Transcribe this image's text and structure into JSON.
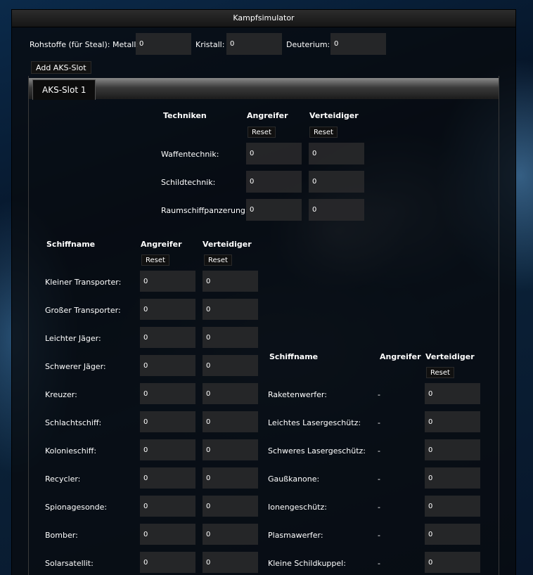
{
  "window": {
    "title": "Kampfsimulator"
  },
  "resources": {
    "label": "Rohstoffe (für Steal): Metall:",
    "metal": "0",
    "crystal_label": "Kristall:",
    "crystal": "0",
    "deuterium_label": "Deuterium:",
    "deuterium": "0"
  },
  "add_slot_label": "Add AKS-Slot",
  "tab_label": "AKS-Slot 1",
  "tech": {
    "header": "Techniken",
    "attacker": "Angreifer",
    "defender": "Verteidiger",
    "reset": "Reset",
    "rows": [
      {
        "name": "Waffentechnik:",
        "attacker": "0",
        "defender": "0"
      },
      {
        "name": "Schildtechnik:",
        "attacker": "0",
        "defender": "0"
      },
      {
        "name": "Raumschiffpanzerung:",
        "attacker": "0",
        "defender": "0"
      }
    ]
  },
  "ships": {
    "header": "Schiffname",
    "attacker": "Angreifer",
    "defender": "Verteidiger",
    "reset": "Reset",
    "rows": [
      {
        "name": "Kleiner Transporter:",
        "attacker": "0",
        "defender": "0"
      },
      {
        "name": "Großer Transporter:",
        "attacker": "0",
        "defender": "0"
      },
      {
        "name": "Leichter Jäger:",
        "attacker": "0",
        "defender": "0"
      },
      {
        "name": "Schwerer Jäger:",
        "attacker": "0",
        "defender": "0"
      },
      {
        "name": "Kreuzer:",
        "attacker": "0",
        "defender": "0"
      },
      {
        "name": "Schlachtschiff:",
        "attacker": "0",
        "defender": "0"
      },
      {
        "name": "Kolonieschiff:",
        "attacker": "0",
        "defender": "0"
      },
      {
        "name": "Recycler:",
        "attacker": "0",
        "defender": "0"
      },
      {
        "name": "Spionagesonde:",
        "attacker": "0",
        "defender": "0"
      },
      {
        "name": "Bomber:",
        "attacker": "0",
        "defender": "0"
      },
      {
        "name": "Solarsatellit:",
        "attacker": "0",
        "defender": "0"
      }
    ]
  },
  "defense": {
    "header": "Schiffname",
    "attacker": "Angreifer",
    "defender": "Verteidiger",
    "reset": "Reset",
    "rows": [
      {
        "name": "Raketenwerfer:",
        "attacker": "-",
        "defender": "0"
      },
      {
        "name": "Leichtes Lasergeschütz:",
        "attacker": "-",
        "defender": "0"
      },
      {
        "name": "Schweres Lasergeschütz:",
        "attacker": "-",
        "defender": "0"
      },
      {
        "name": "Gaußkanone:",
        "attacker": "-",
        "defender": "0"
      },
      {
        "name": "Ionengeschütz:",
        "attacker": "-",
        "defender": "0"
      },
      {
        "name": "Plasmawerfer:",
        "attacker": "-",
        "defender": "0"
      },
      {
        "name": "Kleine Schildkuppel:",
        "attacker": "-",
        "defender": "0"
      }
    ]
  }
}
